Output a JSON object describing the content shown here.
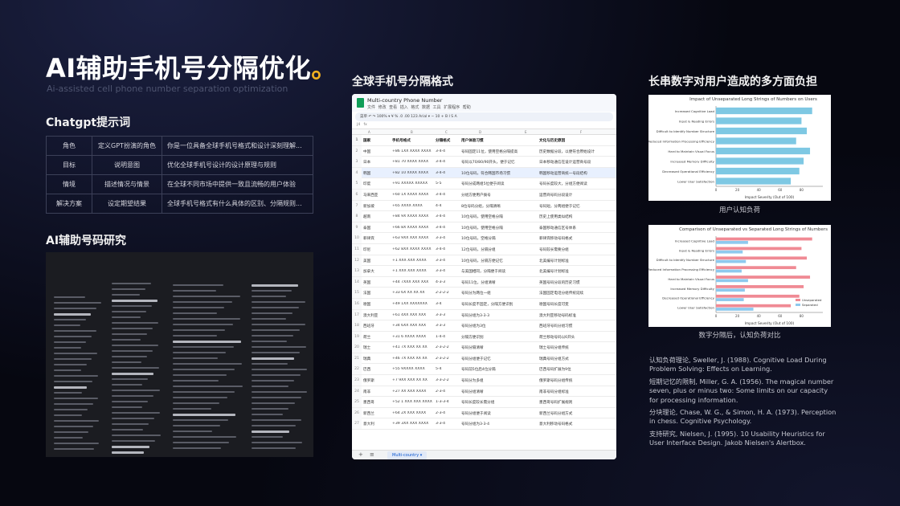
{
  "title": {
    "main": "AI辅助手机号分隔优化",
    "dot": "。",
    "subtitle": "Ai-assisted cell phone number separation optimization"
  },
  "prompt_section": {
    "heading": "Chatgpt提示词",
    "rows": [
      [
        "角色",
        "定义GPT扮演的角色",
        "你是一位具备全球手机号格式和设计深刻理解..."
      ],
      [
        "目标",
        "说明意图",
        "优化全球手机号设计的设计原理与规则"
      ],
      [
        "情境",
        "描述情况与情景",
        "在全球不同市场中提供一致且流畅的用户体验"
      ],
      [
        "解决方案",
        "设定期望结果",
        "全球手机号格式有什么具体的区别、分隔规则..."
      ]
    ]
  },
  "research_section": {
    "heading": "AI辅助号码研究"
  },
  "sheet_section": {
    "heading": "全球手机号分隔格式",
    "doc_title": "Multi-country Phone Number",
    "menu": "文件 修改 查看 插入 格式 数据 工具 扩展程序 帮助",
    "toolbar": "菜单  ↶ ↷  100%  ▾  ¥  %  .0  .00  123  Arial  ▾  −  10  +  B  I  S  A",
    "formula_cell": "J4",
    "formula_fx": "fx",
    "col_letters": [
      "A",
      "B",
      "C",
      "D",
      "E",
      "F"
    ],
    "headers": [
      "国家",
      "手机号格式",
      "分隔格式",
      "用户体验习惯",
      "",
      "文化与历史原因"
    ],
    "rows": [
      [
        "中国",
        "+86 1XX XXXX XXXX",
        "3-4-4",
        "号码固定11位，使用空格分隔提高",
        "",
        "历史数据分段，以便符合原始设计"
      ],
      [
        "日本",
        "+81 70 XXXX XXXX",
        "3-4-4",
        "号码以70/80/90开头，便于记忆",
        "",
        "日本移动通信在设计运营商号段"
      ],
      [
        "韩国",
        "+82 10 XXXX XXXX",
        "3-4-4",
        "10位号码，符合韩国市场习惯",
        "",
        "韩国移动运营商统一号段结构"
      ],
      [
        "印度",
        "+91 XXXXX XXXXX",
        "5-5",
        "号码分成两组5位便于阅读",
        "",
        "号码长度较大，分组方便阅读"
      ],
      [
        "马来西亚",
        "+60 1X XXXX XXXX",
        "3-4-4",
        "分组方便用户拨号",
        "",
        "运营商号码分段设计"
      ],
      [
        "新加坡",
        "+65 XXXX XXXX",
        "4-4",
        "8位号码分组，分隔清晰",
        "",
        "号码短，分两组便于记忆"
      ],
      [
        "越南",
        "+84 9X XXXX XXXX",
        "3-4-4",
        "10位号码，使用空格分隔",
        "",
        "历史上使用类似结构"
      ],
      [
        "泰国",
        "+66 8X XXXX XXXX",
        "3-4-4",
        "10位号码，使用空格分隔",
        "",
        "泰国移动通信区号体系"
      ],
      [
        "菲律宾",
        "+63 9XX XXX XXXX",
        "3-3-4",
        "10位号码，空格分隔",
        "",
        "菲律宾移动号码格式"
      ],
      [
        "印尼",
        "+62 8XX XXXX XXXX",
        "3-4-4",
        "12位号码，分隔分组",
        "",
        "号码较长需要分组"
      ],
      [
        "美国",
        "+1 XXX XXX XXXX",
        "3-3-4",
        "10位号码，分隔方便记忆",
        "",
        "北美编号计划标准"
      ],
      [
        "加拿大",
        "+1 XXX XXX XXXX",
        "3-3-4",
        "与美国相同，分隔便于阅读",
        "",
        "北美编号计划标准"
      ],
      [
        "英国",
        "+44 7XXX XXX XXX",
        "4-3-3",
        "号码11位，分组清晰",
        "",
        "英国号码分段的历史习惯"
      ],
      [
        "法国",
        "+33 6X XX XX XX",
        "2-2-2-2",
        "号码分为两位一组",
        "",
        "法国固定电话分组传统延续"
      ],
      [
        "德国",
        "+49 1XX XXXXXXX",
        "3-4",
        "号码长度不固定，分隔方便识别",
        "",
        "德国号码长度可变"
      ],
      [
        "澳大利亚",
        "+61 4XX XXX XXX",
        "3-3-3",
        "号码分组为3-3-3",
        "",
        "澳大利亚移动号码标准"
      ],
      [
        "西班牙",
        "+34 6XX XXX XXX",
        "3-3-3",
        "号码分组为3位",
        "",
        "西班牙号码分组习惯"
      ],
      [
        "荷兰",
        "+31 6 XXXX XXXX",
        "1-4-4",
        "分隔方便识别",
        "",
        "荷兰移动号码以6开头"
      ],
      [
        "瑞士",
        "+41 7X XXX XX XX",
        "2-3-2-2",
        "号码分隔清晰",
        "",
        "瑞士号码分组传统"
      ],
      [
        "瑞典",
        "+46 7X XXX XX XX",
        "2-3-2-2",
        "号码分组便于记忆",
        "",
        "瑞典号码分组方式"
      ],
      [
        "巴西",
        "+55 9XXXX XXXX",
        "5-4",
        "号码前5位后4位分隔",
        "",
        "巴西号码扩展为9位"
      ],
      [
        "俄罗斯",
        "+7 9XX XXX XX XX",
        "3-3-2-2",
        "号码分为多组",
        "",
        "俄罗斯号码分组传统"
      ],
      [
        "南非",
        "+27 XX XXX XXXX",
        "2-3-4",
        "号码分组清晰",
        "",
        "南非号码分组标准"
      ],
      [
        "墨西哥",
        "+52 1 XXX XXX XXXX",
        "1-3-3-4",
        "号码长度较长需分组",
        "",
        "墨西哥号码扩展规则"
      ],
      [
        "新西兰",
        "+64 2X XXX XXXX",
        "2-3-4",
        "号码分组便于阅读",
        "",
        "新西兰号码分组方式"
      ],
      [
        "意大利",
        "+39 3XX XXX XXXX",
        "3-3-4",
        "号码分组为3-3-4",
        "",
        "意大利移动号码格式"
      ]
    ],
    "tab_label": "Multi-country ▾"
  },
  "burden_section": {
    "heading": "长串数字对用户造成的多方面负担",
    "caption1": "用户认知负荷",
    "caption2": "数字分隔后，认知负荷对比"
  },
  "chart_data": [
    {
      "type": "bar",
      "orientation": "horizontal",
      "title": "Impact of Unseparated Long Strings of Numbers on Users",
      "xlabel": "Impact Severity (Out of 100)",
      "categories": [
        "Increased Cognitive Load",
        "Input & Reading Errors",
        "Difficult to Identify Number Structure",
        "Reduced Information Processing Efficiency",
        "Hard to Maintain Visual Focus",
        "Increased Memory Difficulty",
        "Decreased Operational Efficiency",
        "Lower User Satisfaction"
      ],
      "values": [
        90,
        80,
        85,
        75,
        88,
        82,
        78,
        70
      ],
      "xlim": [
        0,
        100
      ],
      "xticks": [
        0,
        20,
        40,
        60,
        80
      ],
      "color": "#7ec8e3"
    },
    {
      "type": "bar",
      "orientation": "horizontal",
      "title": "Comparison of Unseparated vs Separated Long Strings of Numbers",
      "xlabel": "Impact Severity (Out of 100)",
      "categories": [
        "Increased Cognitive Load",
        "Input & Reading Errors",
        "Difficult to Identify Number Structure",
        "Reduced Information Processing Efficiency",
        "Hard to Maintain Visual Focus",
        "Increased Memory Difficulty",
        "Decreased Operational Efficiency",
        "Lower User Satisfaction"
      ],
      "series": [
        {
          "name": "Unseparated",
          "values": [
            90,
            80,
            85,
            75,
            88,
            82,
            78,
            70
          ],
          "color": "#f08a94"
        },
        {
          "name": "Separated",
          "values": [
            30,
            25,
            28,
            24,
            30,
            27,
            26,
            35
          ],
          "color": "#8ec9ee"
        }
      ],
      "xlim": [
        0,
        100
      ],
      "xticks": [
        0,
        20,
        40,
        60,
        80
      ],
      "legend": "bottom-right"
    }
  ],
  "references": [
    "认知负荷理论, Sweller, J. (1988). Cognitive Load During Problem Solving: Effects on Learning.",
    "短期记忆的限制, Miller, G. A. (1956). The magical number seven, plus or minus two: Some limits on our capacity for processing information.",
    "分块理论, Chase, W. G., & Simon, H. A. (1973). Perception in chess. Cognitive Psychology.",
    "支持研究, Nielsen, J. (1995). 10 Usability Heuristics for User Interface Design. Jakob Nielsen's Alertbox."
  ]
}
